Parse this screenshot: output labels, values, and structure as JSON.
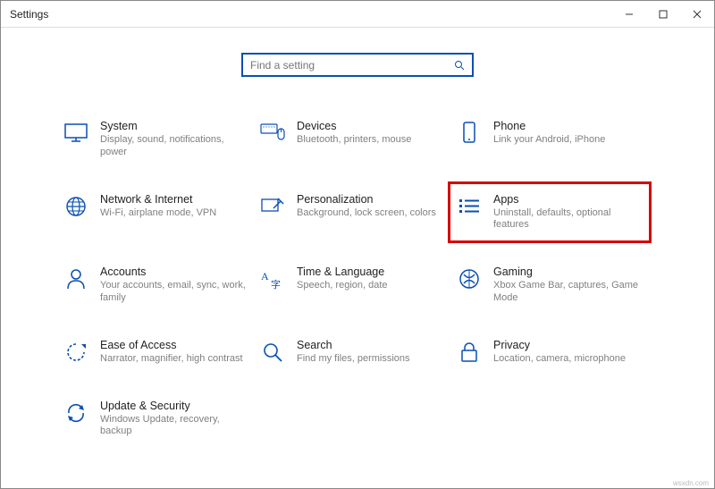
{
  "window": {
    "title": "Settings"
  },
  "search": {
    "placeholder": "Find a setting"
  },
  "tiles": {
    "system": {
      "title": "System",
      "sub": "Display, sound, notifications, power"
    },
    "devices": {
      "title": "Devices",
      "sub": "Bluetooth, printers, mouse"
    },
    "phone": {
      "title": "Phone",
      "sub": "Link your Android, iPhone"
    },
    "network": {
      "title": "Network & Internet",
      "sub": "Wi-Fi, airplane mode, VPN"
    },
    "personalization": {
      "title": "Personalization",
      "sub": "Background, lock screen, colors"
    },
    "apps": {
      "title": "Apps",
      "sub": "Uninstall, defaults, optional features"
    },
    "accounts": {
      "title": "Accounts",
      "sub": "Your accounts, email, sync, work, family"
    },
    "time": {
      "title": "Time & Language",
      "sub": "Speech, region, date"
    },
    "gaming": {
      "title": "Gaming",
      "sub": "Xbox Game Bar, captures, Game Mode"
    },
    "ease": {
      "title": "Ease of Access",
      "sub": "Narrator, magnifier, high contrast"
    },
    "search_tile": {
      "title": "Search",
      "sub": "Find my files, permissions"
    },
    "privacy": {
      "title": "Privacy",
      "sub": "Location, camera, microphone"
    },
    "update": {
      "title": "Update & Security",
      "sub": "Windows Update, recovery, backup"
    }
  },
  "watermark": "wsxdn.com"
}
